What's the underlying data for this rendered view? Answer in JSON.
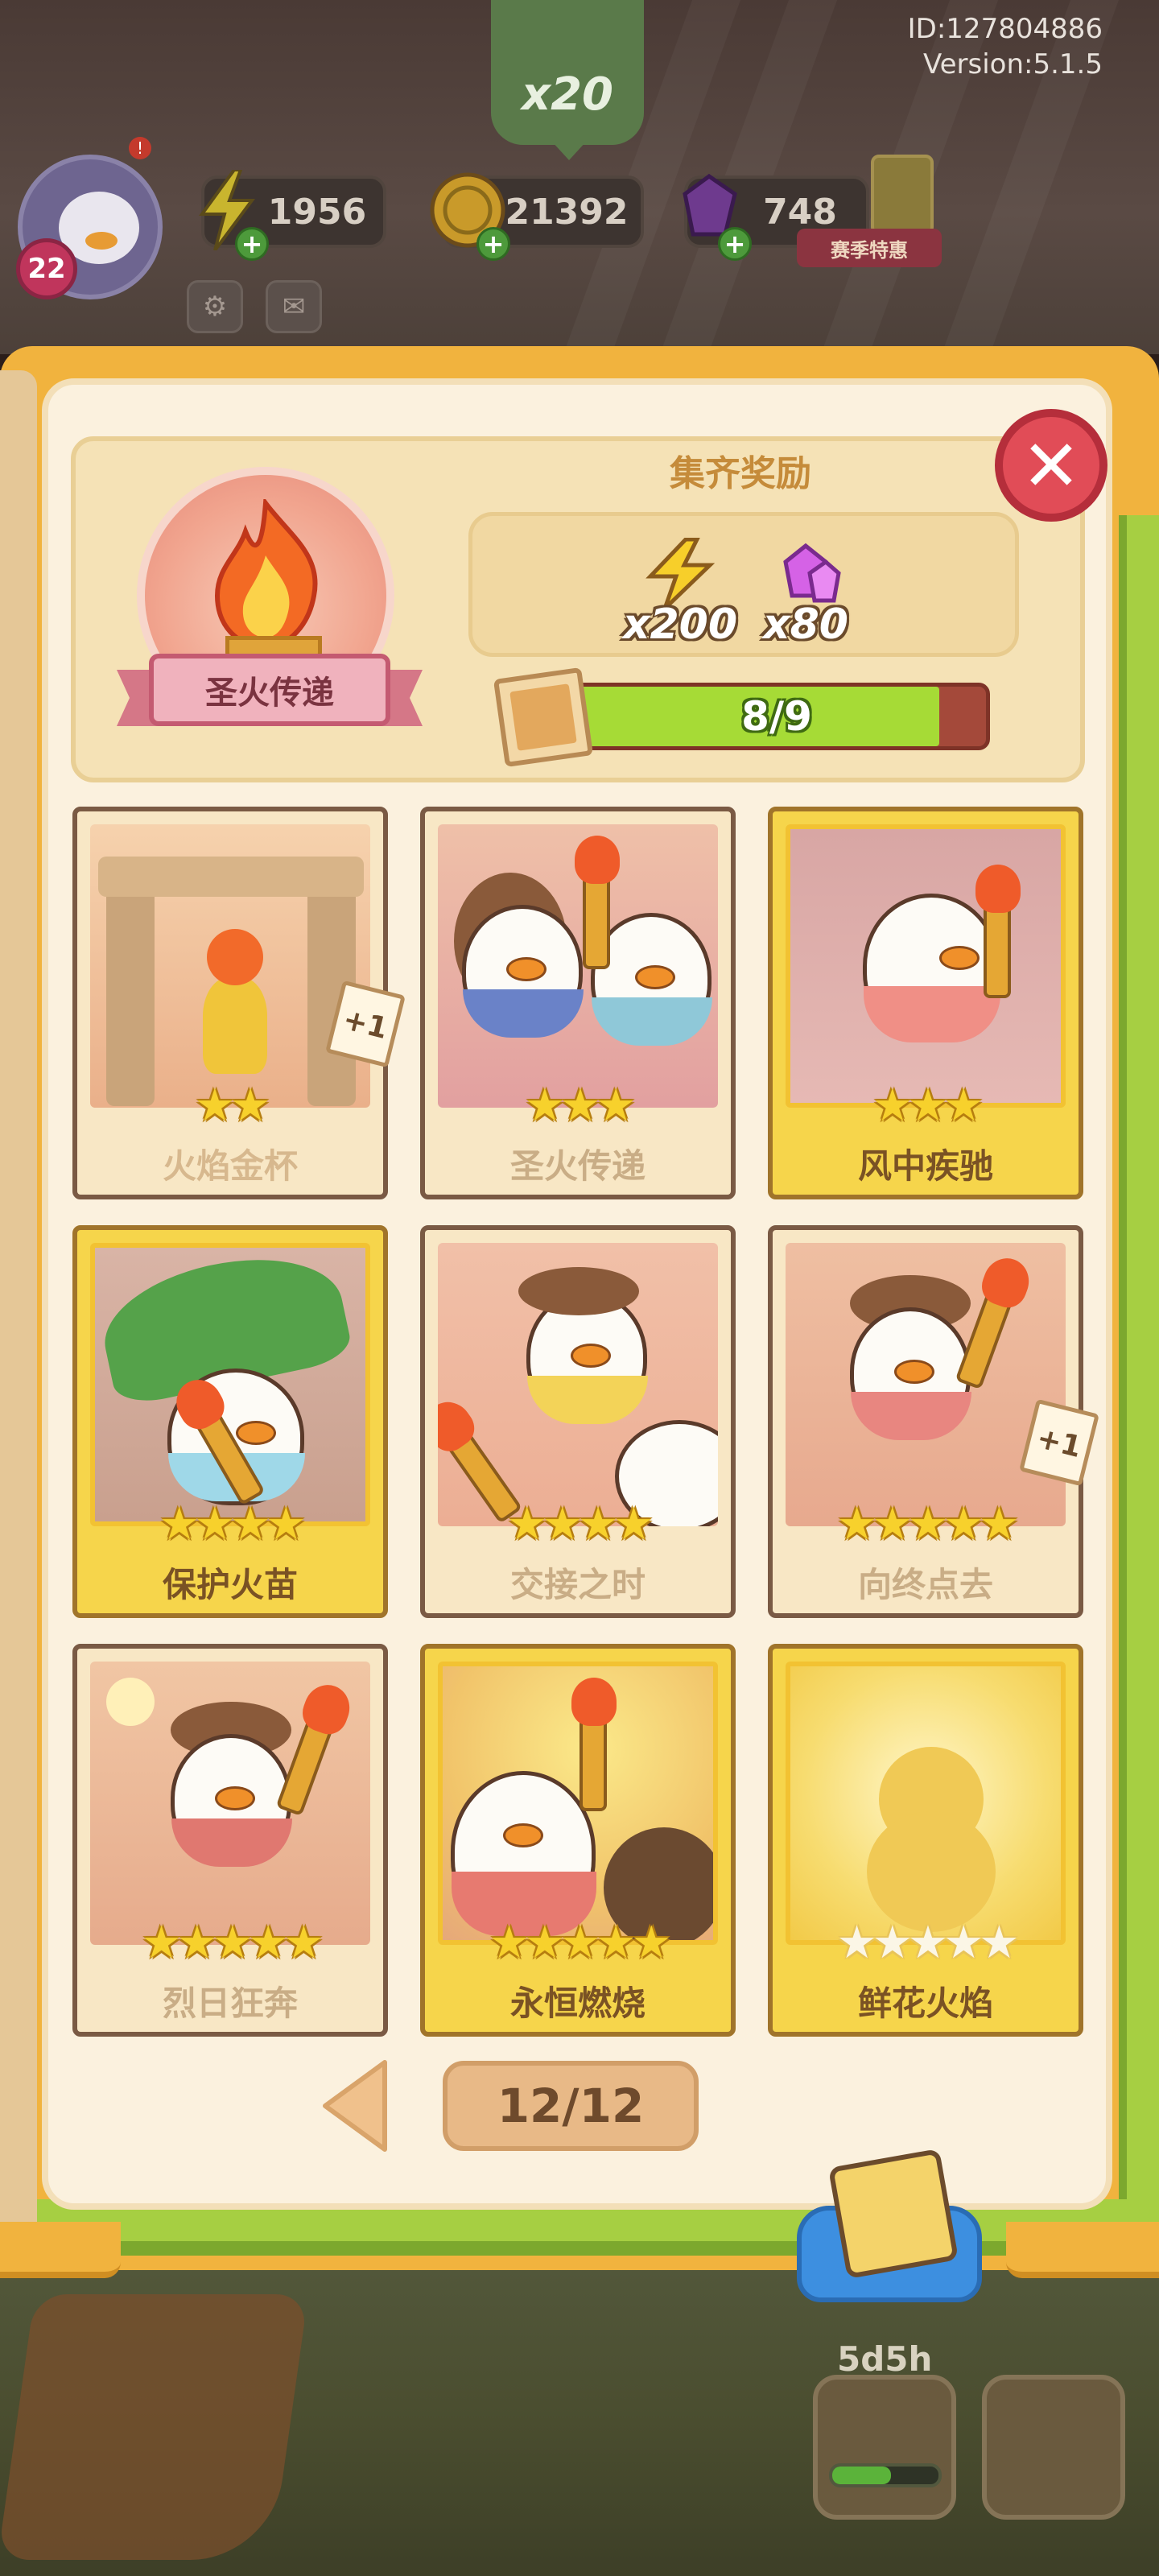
{
  "top": {
    "sprout_count": "x20",
    "player_id": "ID:127804886",
    "version": "Version:5.1.5",
    "level": "22",
    "alert_mark": "!"
  },
  "resources": {
    "energy": "1956",
    "coins": "21392",
    "gems": "748",
    "season_label": "赛季特惠"
  },
  "set": {
    "name": "圣火传递",
    "reward_title": "集齐奖励",
    "rewards": [
      {
        "icon": "lightning-icon",
        "amount": "x200"
      },
      {
        "icon": "gem-icon",
        "amount": "x80"
      }
    ],
    "progress_label": "8/9",
    "progress_fraction": 0.889
  },
  "cards": [
    {
      "name": "火焰金杯",
      "stars": "★★",
      "style": "dim",
      "extra": "+1"
    },
    {
      "name": "圣火传递",
      "stars": "★★★",
      "style": "dim",
      "extra": ""
    },
    {
      "name": "风中疾驰",
      "stars": "★★★",
      "style": "gold",
      "extra": ""
    },
    {
      "name": "保护火苗",
      "stars": "★★★★",
      "style": "gold",
      "extra": ""
    },
    {
      "name": "交接之时",
      "stars": "★★★★",
      "style": "dim",
      "extra": ""
    },
    {
      "name": "向终点去",
      "stars": "★★★★★",
      "style": "dim",
      "extra": "+1"
    },
    {
      "name": "烈日狂奔",
      "stars": "★★★★★",
      "style": "dim",
      "extra": ""
    },
    {
      "name": "永恒燃烧",
      "stars": "★★★★★",
      "style": "gold",
      "extra": ""
    },
    {
      "name": "鲜花火焰",
      "stars": "★★★★★",
      "style": "gold-locked",
      "extra": ""
    }
  ],
  "pager": {
    "page_label": "12/12"
  },
  "bottom": {
    "timer": "5d5h"
  },
  "colors": {
    "book_orange": "#f1b33e",
    "page_cream": "#fbf1de",
    "progress_green": "#a6db36",
    "close_red": "#e14c57"
  }
}
